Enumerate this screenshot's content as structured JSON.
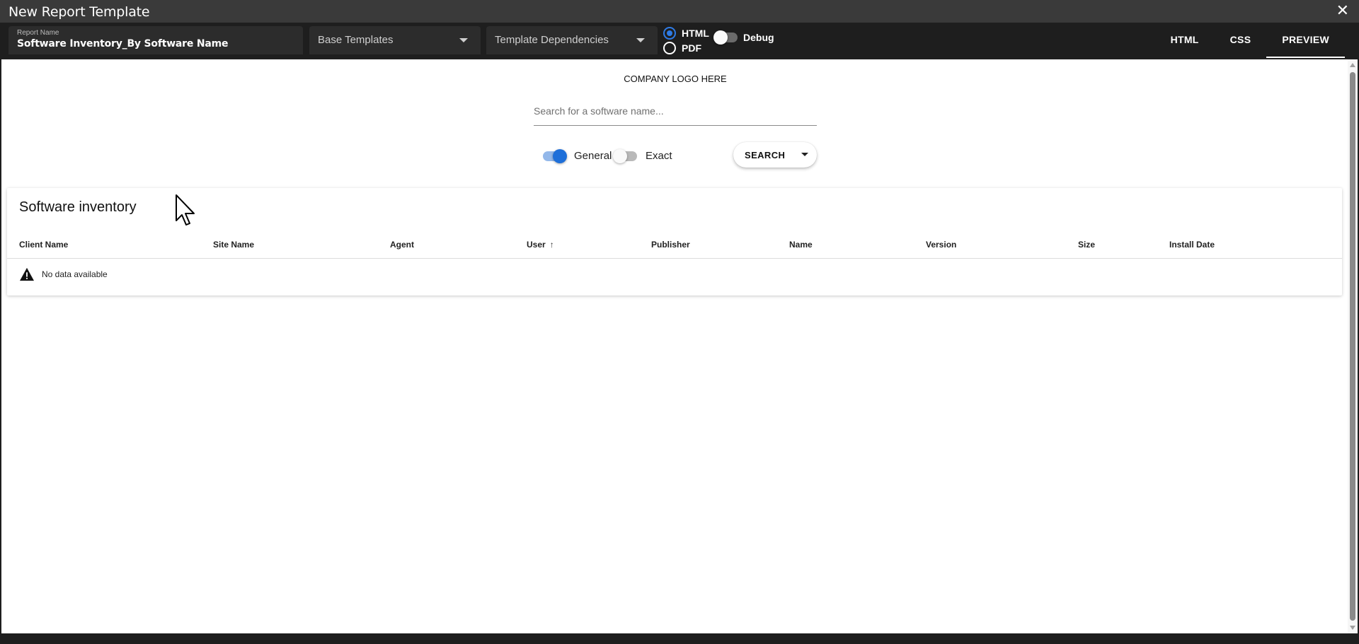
{
  "window": {
    "title": "New Report Template",
    "close_icon": "close-icon"
  },
  "toolbar": {
    "report_name": {
      "label": "Report Name",
      "value": "Software Inventory_By Software Name"
    },
    "base_templates": {
      "label": "Base Templates"
    },
    "template_dependencies": {
      "label": "Template Dependencies"
    },
    "format": {
      "options": [
        "HTML",
        "PDF"
      ],
      "selected": "HTML"
    },
    "debug": {
      "label": "Debug",
      "enabled": false
    },
    "tabs": [
      {
        "label": "HTML",
        "active": false
      },
      {
        "label": "CSS",
        "active": false
      },
      {
        "label": "PREVIEW",
        "active": true
      }
    ]
  },
  "preview": {
    "logo_text": "COMPANY LOGO HERE",
    "search": {
      "placeholder": "Search for a software name..."
    },
    "match_mode": {
      "general": {
        "label": "General",
        "on": true
      },
      "exact": {
        "label": "Exact",
        "on": false
      }
    },
    "search_button": {
      "label": "SEARCH"
    },
    "table": {
      "title": "Software inventory",
      "columns": [
        "Client Name",
        "Site Name",
        "Agent",
        "User",
        "Publisher",
        "Name",
        "Version",
        "Size",
        "Install Date"
      ],
      "sorted_column": "User",
      "sort_direction": "ascending",
      "empty_message": "No data available"
    }
  },
  "colors": {
    "accent": "#1e6fd9",
    "toolbar_bg": "#1e1e1e",
    "titlebar_bg": "#3a3a3a"
  }
}
